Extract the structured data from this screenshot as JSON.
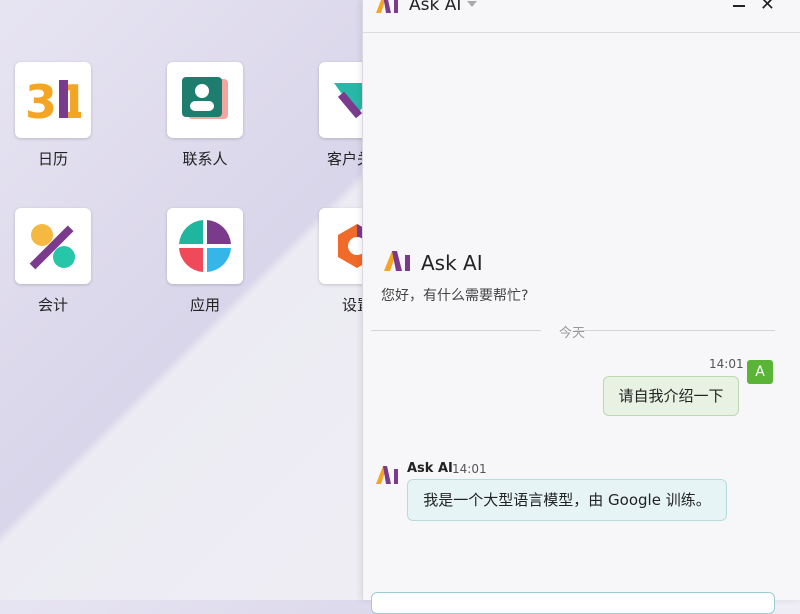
{
  "apps": [
    {
      "label": "日历",
      "icon": "calendar-icon",
      "number": "31"
    },
    {
      "label": "联系人",
      "icon": "contacts-icon"
    },
    {
      "label": "客户关系",
      "icon": "crm-icon"
    },
    {
      "label": "会计",
      "icon": "accounting-icon"
    },
    {
      "label": "应用",
      "icon": "apps-icon"
    },
    {
      "label": "设置",
      "icon": "settings-icon"
    }
  ],
  "panel": {
    "title": "Ask AI",
    "welcome_title": "Ask AI",
    "welcome_subtitle": "您好，有什么需要帮忙?",
    "divider_label": "今天"
  },
  "messages": {
    "user": {
      "avatar": "A",
      "time": "14:01",
      "text": "请自我介绍一下"
    },
    "bot": {
      "name": "Ask AI",
      "time": "14:01",
      "text": "我是一个大型语言模型，由 Google 训练。"
    }
  },
  "colors": {
    "accent_green": "#5ab537",
    "brand_purple": "#7a3b8c",
    "brand_orange": "#f5a524"
  }
}
